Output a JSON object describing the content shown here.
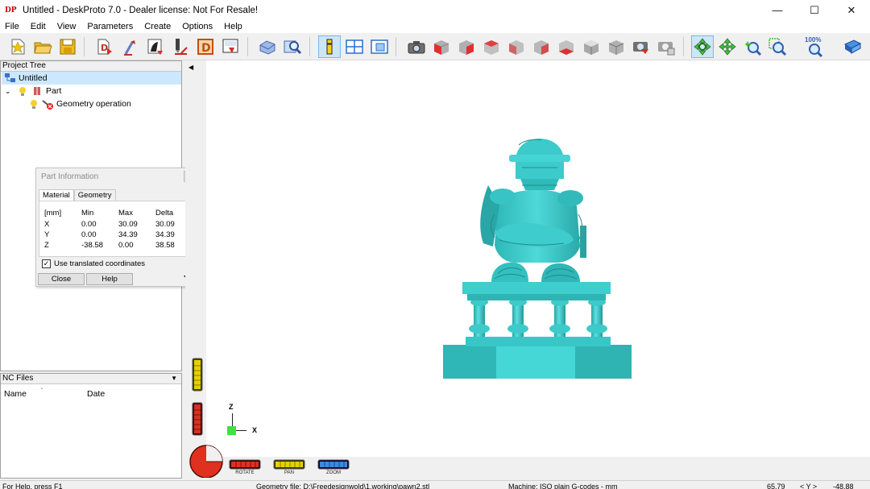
{
  "window": {
    "icon_text": "DP",
    "title": "Untitled - DeskProto 7.0 - Dealer license: Not For Resale!",
    "minimize": "—",
    "maximize": "☐",
    "close": "✕"
  },
  "menu": [
    "File",
    "Edit",
    "View",
    "Parameters",
    "Create",
    "Options",
    "Help"
  ],
  "toolbar": {
    "zoom_100_label": "100%",
    "icons": [
      "new-file-icon",
      "open-file-icon",
      "save-file-icon",
      "import-geometry-icon",
      "import-vector-icon",
      "import-bitmap-icon",
      "cutter-icon",
      "dxf-icon",
      "export-icon",
      "machine-icon",
      "preview-icon",
      "part-info-icon",
      "layout-icon",
      "view-panel-icon",
      "camera-icon",
      "view-front-icon",
      "view-back-icon",
      "view-left-icon",
      "view-right-icon",
      "view-top-icon",
      "view-bottom-icon",
      "view-iso-icon",
      "view-iso2-icon",
      "render-icon",
      "render2-icon",
      "rotate-tool-icon",
      "pan-tool-icon",
      "zoom-tool-icon",
      "zoom-window-icon",
      "zoom-100-icon",
      "book-icon"
    ]
  },
  "project_tree": {
    "header": "Project Tree",
    "items": [
      {
        "label": "Untitled",
        "level": 0
      },
      {
        "label": "Part",
        "level": 1
      },
      {
        "label": "Geometry operation",
        "level": 2
      }
    ]
  },
  "nc_files": {
    "header": "NC Files",
    "columns": [
      "Name",
      "Date"
    ]
  },
  "part_info": {
    "title": "Part Information",
    "tabs": [
      "Material",
      "Geometry"
    ],
    "headers": [
      "[mm]",
      "Min",
      "Max",
      "Delta"
    ],
    "rows": [
      {
        "axis": "X",
        "min": "0.00",
        "max": "30.09",
        "delta": "30.09"
      },
      {
        "axis": "Y",
        "min": "0.00",
        "max": "34.39",
        "delta": "34.39"
      },
      {
        "axis": "Z",
        "min": "-38.58",
        "max": "0.00",
        "delta": "38.58"
      }
    ],
    "checkbox_label": "Use translated coordinates",
    "checkbox_checked": true,
    "close_label": "Close",
    "help_label": "Help"
  },
  "viewport": {
    "axis_z": "Z",
    "axis_x": "X",
    "rotate_label": "ROTATE",
    "pan_label": "PAN",
    "zoom_label": "ZOOM",
    "model_color": "#3ec9c9"
  },
  "status": {
    "help": "For Help, press F1",
    "geometry": "Geometry file: D:\\Freedesignwold\\1.working\\pawn2.stl",
    "machine": "Machine: ISO plain G-codes - mm",
    "x": "65.79",
    "y_label": "< Y >",
    "y": "-48.88"
  }
}
